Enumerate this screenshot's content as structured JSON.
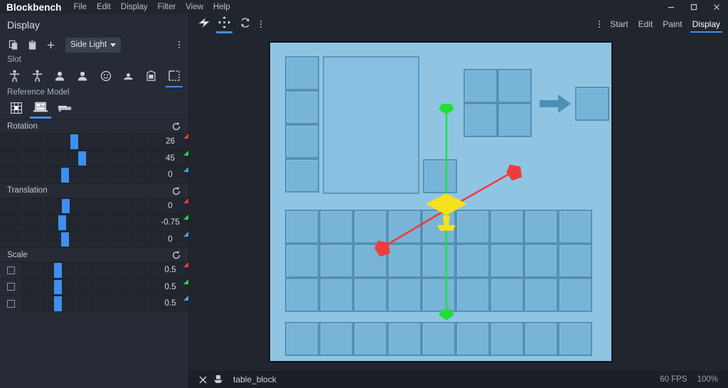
{
  "window": {
    "brand": "Blockbench",
    "menus": [
      "File",
      "Edit",
      "Display",
      "Filter",
      "View",
      "Help"
    ],
    "controls": {
      "minimize": "minimize-icon",
      "maximize": "maximize-icon",
      "close": "close-icon"
    }
  },
  "sidebar": {
    "title": "Display",
    "toolbar": {
      "copy_icon": "copy-icon",
      "paste_icon": "paste-icon",
      "add_icon": "plus-icon",
      "preset_label": "Side Light",
      "preset_caret": "chevron-down-icon",
      "more_icon": "kebab-menu-icon"
    },
    "slot": {
      "label": "Slot",
      "options": [
        {
          "name": "thirdperson-righthand",
          "icon": "person-arms-out-icon",
          "active": false
        },
        {
          "name": "thirdperson-lefthand",
          "icon": "person-arms-out-icon",
          "active": false
        },
        {
          "name": "firstperson-righthand",
          "icon": "person-bust-icon",
          "active": false
        },
        {
          "name": "firstperson-lefthand",
          "icon": "person-bust-icon",
          "active": false
        },
        {
          "name": "head",
          "icon": "smiley-face-icon",
          "active": false
        },
        {
          "name": "ground",
          "icon": "person-ground-icon",
          "active": false
        },
        {
          "name": "fixed",
          "icon": "item-frame-icon",
          "active": false
        },
        {
          "name": "gui",
          "icon": "gui-square-icon",
          "active": true
        }
      ]
    },
    "reference_model": {
      "label": "Reference Model",
      "options": [
        {
          "name": "grid",
          "icon": "checker-grid-icon",
          "active": false
        },
        {
          "name": "inventory-gui",
          "icon": "inventory-screen-icon",
          "active": true
        },
        {
          "name": "bench",
          "icon": "bench-block-icon",
          "active": false
        }
      ]
    },
    "groups": [
      {
        "name": "rotation",
        "title": "Rotation",
        "reset_icon": "reset-icon",
        "has_checkboxes": false,
        "axes": [
          {
            "axis": "x",
            "color": "#ef3b3b",
            "value": "26",
            "knob_pct": 46.5
          },
          {
            "axis": "y",
            "color": "#2fd34a",
            "value": "45",
            "knob_pct": 51.5
          },
          {
            "axis": "z",
            "color": "#3ba7ef",
            "value": "0",
            "knob_pct": 40.5
          }
        ]
      },
      {
        "name": "translation",
        "title": "Translation",
        "reset_icon": "reset-icon",
        "has_checkboxes": false,
        "axes": [
          {
            "axis": "x",
            "color": "#ef3b3b",
            "value": "0",
            "knob_pct": 41.0
          },
          {
            "axis": "y",
            "color": "#2fd34a",
            "value": "-0.75",
            "knob_pct": 38.5
          },
          {
            "axis": "z",
            "color": "#3ba7ef",
            "value": "0",
            "knob_pct": 40.5
          }
        ]
      },
      {
        "name": "scale",
        "title": "Scale",
        "reset_icon": "reset-icon",
        "has_checkboxes": true,
        "axes": [
          {
            "axis": "x",
            "color": "#ef3b3b",
            "value": "0.5",
            "knob_pct": 25.0,
            "checked": false
          },
          {
            "axis": "y",
            "color": "#2fd34a",
            "value": "0.5",
            "knob_pct": 25.0,
            "checked": false
          },
          {
            "axis": "z",
            "color": "#3ba7ef",
            "value": "0.5",
            "knob_pct": 25.0,
            "checked": false
          }
        ]
      }
    ]
  },
  "viewport": {
    "tools": [
      {
        "name": "pivot-tool",
        "icon": "pivot-arrow-icon",
        "active": false
      },
      {
        "name": "move-tool",
        "icon": "move-arrows-icon",
        "active": true
      },
      {
        "name": "rotate-tool",
        "icon": "rotate-arrows-icon",
        "active": false
      }
    ],
    "more_icon": "kebab-menu-icon",
    "mode_tabs": [
      {
        "label": "Start",
        "active": false
      },
      {
        "label": "Edit",
        "active": false
      },
      {
        "label": "Paint",
        "active": false
      },
      {
        "label": "Display",
        "active": true
      }
    ],
    "reference": {
      "kind": "minecraft-inventory-gui",
      "colors": {
        "background": "#8fc5e3",
        "slot_fill": "#78b4d7",
        "slot_border": "#5590b5",
        "panel_fill": "#86bfe0",
        "outline": "#111520",
        "arrow": "#4d8fb5"
      },
      "crafting_grid": {
        "columns": 2,
        "rows": 2
      },
      "arrow_icon": "right-arrow-icon",
      "output_slots": 1,
      "armor_slots": 4,
      "offhand_slots": 1,
      "player_preview_panel": true,
      "inventory_grid": {
        "columns": 9,
        "rows": 3
      },
      "hotbar": {
        "columns": 9,
        "rows": 1
      }
    },
    "gizmo": {
      "type": "move-gizmo",
      "axes": [
        {
          "axis": "x",
          "color": "#f03c3c"
        },
        {
          "axis": "y",
          "color": "#22dd3a"
        }
      ],
      "center_color": "#f5e11e"
    }
  },
  "statusbar": {
    "close_icon": "close-icon",
    "format_icon": "block-model-icon",
    "project_name": "table_block",
    "fps": "60 FPS",
    "zoom": "100%"
  }
}
